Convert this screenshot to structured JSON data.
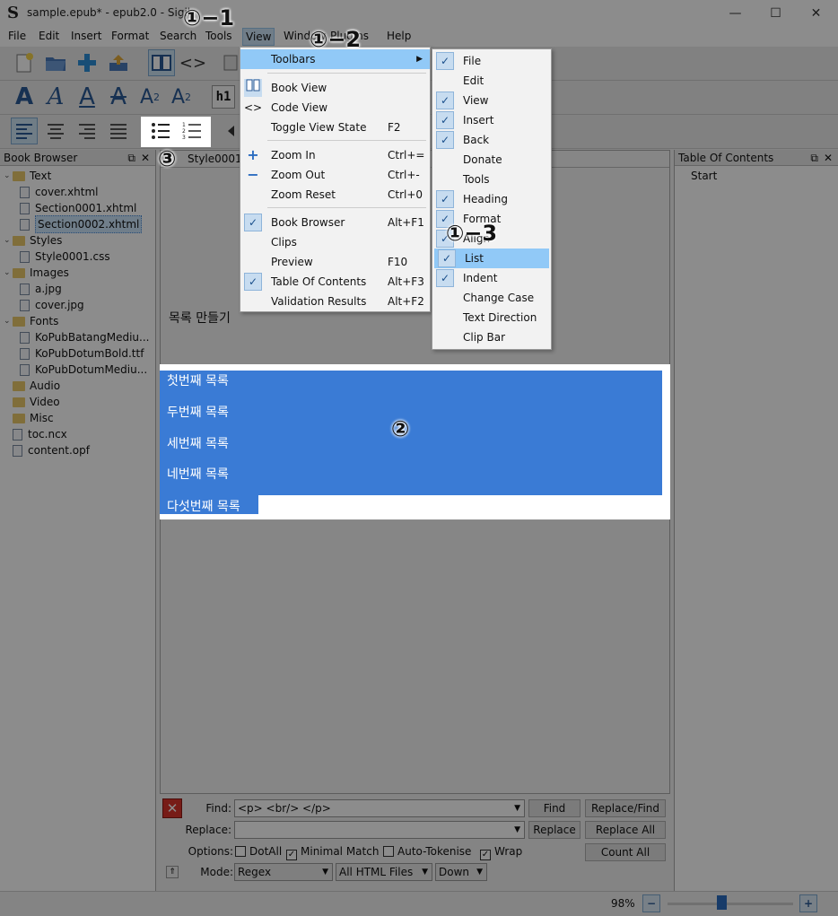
{
  "window": {
    "title": "sample.epub* - epub2.0 - Sigil",
    "logo": "S",
    "minimize": "—",
    "maximize": "☐",
    "close": "✕"
  },
  "menubar": {
    "items": [
      "File",
      "Edit",
      "Insert",
      "Format",
      "Search",
      "Tools",
      "View",
      "Window",
      "Plugins",
      "Help"
    ]
  },
  "view_menu": {
    "items": [
      {
        "label": "Toolbars",
        "shortcut": "",
        "submenu": true
      },
      {
        "label": "Book View",
        "shortcut": "",
        "icon": "book-icon"
      },
      {
        "label": "Code View",
        "shortcut": "",
        "icon": "code-icon"
      },
      {
        "label": "Toggle View State",
        "shortcut": "F2"
      },
      {
        "label": "Zoom In",
        "shortcut": "Ctrl+="
      },
      {
        "label": "Zoom Out",
        "shortcut": "Ctrl+-"
      },
      {
        "label": "Zoom Reset",
        "shortcut": "Ctrl+0"
      },
      {
        "label": "Book Browser",
        "shortcut": "Alt+F1",
        "checked": true
      },
      {
        "label": "Clips",
        "shortcut": ""
      },
      {
        "label": "Preview",
        "shortcut": "F10"
      },
      {
        "label": "Table Of Contents",
        "shortcut": "Alt+F3",
        "checked": true
      },
      {
        "label": "Validation Results",
        "shortcut": "Alt+F2"
      }
    ]
  },
  "toolbars_submenu": {
    "items": [
      {
        "label": "File",
        "checked": true
      },
      {
        "label": "Edit",
        "checked": false
      },
      {
        "label": "View",
        "checked": true
      },
      {
        "label": "Insert",
        "checked": true
      },
      {
        "label": "Back",
        "checked": true
      },
      {
        "label": "Donate",
        "checked": false
      },
      {
        "label": "Tools",
        "checked": false
      },
      {
        "label": "Heading",
        "checked": true
      },
      {
        "label": "Format",
        "checked": true
      },
      {
        "label": "Align",
        "checked": true
      },
      {
        "label": "List",
        "checked": true
      },
      {
        "label": "Indent",
        "checked": true
      },
      {
        "label": "Change Case",
        "checked": false
      },
      {
        "label": "Text Direction",
        "checked": false
      },
      {
        "label": "Clip Bar",
        "checked": false
      }
    ]
  },
  "annotations": {
    "one_one": "①−1",
    "one_two": "①−2",
    "one_three": "①−3",
    "two": "②",
    "three": "③"
  },
  "toolbar": {
    "heading_button": "h1"
  },
  "book_browser": {
    "title": "Book Browser",
    "tree": [
      {
        "label": "Text",
        "type": "folder",
        "level": 0
      },
      {
        "label": "cover.xhtml",
        "type": "file",
        "level": 1
      },
      {
        "label": "Section0001.xhtml",
        "type": "file",
        "level": 1
      },
      {
        "label": "Section0002.xhtml",
        "type": "file",
        "level": 1,
        "selected": true
      },
      {
        "label": "Styles",
        "type": "folder",
        "level": 0
      },
      {
        "label": "Style0001.css",
        "type": "file",
        "level": 1
      },
      {
        "label": "Images",
        "type": "folder",
        "level": 0
      },
      {
        "label": "a.jpg",
        "type": "file",
        "level": 1
      },
      {
        "label": "cover.jpg",
        "type": "file",
        "level": 1
      },
      {
        "label": "Fonts",
        "type": "folder",
        "level": 0
      },
      {
        "label": "KoPubBatangMediu...",
        "type": "file",
        "level": 1
      },
      {
        "label": "KoPubDotumBold.ttf",
        "type": "file",
        "level": 1
      },
      {
        "label": "KoPubDotumMediu...",
        "type": "file",
        "level": 1
      },
      {
        "label": "Audio",
        "type": "folder",
        "level": 0
      },
      {
        "label": "Video",
        "type": "folder",
        "level": 0
      },
      {
        "label": "Misc",
        "type": "folder",
        "level": 0
      },
      {
        "label": "toc.ncx",
        "type": "file",
        "level": 0
      },
      {
        "label": "content.opf",
        "type": "file",
        "level": 0
      }
    ]
  },
  "editor": {
    "tab_label": "Style0001.",
    "heading": "목록 만들기",
    "list_items": [
      "첫번째 목록",
      "두번째 목록",
      "세번째 목록",
      "네번째 목록",
      "다섯번째 목록"
    ]
  },
  "toc": {
    "title": "Table Of Contents",
    "items": [
      "Start"
    ]
  },
  "find_panel": {
    "find_label": "Find:",
    "find_value": "<p> <br/> </p>",
    "replace_label": "Replace:",
    "replace_value": "",
    "options_label": "Options:",
    "mode_label": "Mode:",
    "mode_value": "Regex",
    "scope_value": "All HTML Files",
    "direction_value": "Down",
    "btn_find": "Find",
    "btn_replace_find": "Replace/Find",
    "btn_replace": "Replace",
    "btn_replace_all": "Replace All",
    "btn_count_all": "Count All",
    "opt_dotall": "DotAll",
    "opt_minimal": "Minimal Match",
    "opt_autotokenise": "Auto-Tokenise",
    "opt_wrap": "Wrap"
  },
  "status": {
    "zoom": "98%",
    "zoom_fraction": 0.43
  },
  "colors": {
    "selection": "#3a7bd5",
    "highlight": "#91c9f7",
    "check": "#1a4f8b"
  }
}
